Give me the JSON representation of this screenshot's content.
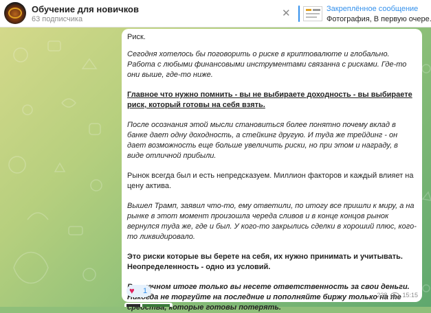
{
  "header": {
    "title": "Обучение для новичков",
    "subtitle": "63 подписчика",
    "pinned_title": "Закреплённое сообщение",
    "pinned_text": "Фотография, В первую очере..."
  },
  "message": {
    "p1": "Риск.",
    "p2a": "Сегодня хотелось бы поговорить о риске в криптовалюте и глобально.",
    "p2b": "Работа с любыми финансовыми инструментами связанна с рисками. Где-то они выше, где-то ниже.",
    "p3": "Главное что нужно помнить - вы не выбираете доходность - вы выбираете риск, который готовы на себя взять.",
    "p4": "После осознания этой мысли становиться более понятно почему вклад в банке дает одну доходность, а стейкинг другую. И туда же трейдинг - он дает возможность еще больше увеличить риски, но при этом и награду, в виде отличной прибыли.",
    "p5": "Рынок всегда был и есть непредсказуем. Миллион факторов и каждый влияет на цену актива.",
    "p6": "Вышел Трамп, заявил что-то, ему ответили, по итогу все пришли к миру, а на рынке в этот момент произошла череда сливов и в конце концов рынок вернулся туда же, где и был. У кого-то закрылись сделки в хороший плюс, кого-то ликвидировало.",
    "p7a": "Это риски которые вы берете на себя,  их нужно принимать и учитывать.",
    "p7b": "Неопределенность - одно из условий.",
    "p8": "В конечном итоге только вы несете ответственность за свои деньги. Никогда не торгуйте на последние и пополняйте биржу только на те средства, которые готовы потерять.",
    "reaction_emoji": "♥",
    "reaction_count": "1",
    "views": "228",
    "time": "15:15"
  },
  "icons": {
    "close": "close-icon",
    "views": "eye-icon",
    "reaction": "heart-icon"
  },
  "colors": {
    "accent": "#3390ec",
    "reaction": "#e0245e",
    "background_top": "#d4d98a",
    "background_bottom": "#5fa86e"
  }
}
